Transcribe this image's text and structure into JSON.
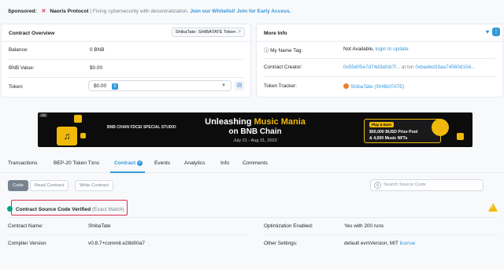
{
  "sponsor": {
    "label": "Sponsored:",
    "brand": "Naoris Protocol",
    "desc": " | Fixing cybersecurity with decentralization.",
    "cta": "Join our Whitelist! Join for Early Access."
  },
  "overview": {
    "title": "Contract Overview",
    "token_pill": "ShibaTate: SHIBATATE Token",
    "rows": [
      {
        "key": "Balance:",
        "value": "0 BNB"
      },
      {
        "key": "BNB Value:",
        "value": "$0.00"
      },
      {
        "key": "Token:",
        "value": "$0.00",
        "badge": "5"
      }
    ]
  },
  "more_info": {
    "title": "More Info",
    "name_tag_key": "My Name Tag:",
    "name_tag_value": "Not Available,",
    "name_tag_link": "login to update",
    "creator_key": "Contract Creator:",
    "creator_addr": "0x55d05e7d74d3afcb7f...",
    "creator_at": "at txn",
    "creator_txn": "0xbaded33aa74560d154...",
    "tracker_key": "Token Tracker:",
    "tracker_value": "ShibaTate (SHIBATATE)"
  },
  "banner": {
    "ad": "AD",
    "partners": "BNB CHAIN    FDCEI    SPECIAL STUDIO",
    "headline_a": "Unleashing ",
    "headline_b": "Music Mania",
    "headline2": "on BNB Chain",
    "dates": "July 21 - Aug 31, 2022",
    "promo_tag": "Play & Earn",
    "promo_line1": "$50,000 BUSD Prize Pool",
    "promo_line2": "& 4,000 Music NFTs"
  },
  "tabs": [
    "Transactions",
    "BEP-20 Token Txns",
    "Contract",
    "Events",
    "Analytics",
    "Info",
    "Comments"
  ],
  "subtabs": [
    "Code",
    "Read Contract",
    "Write Contract"
  ],
  "search": {
    "placeholder": "Search Source Code"
  },
  "verified": {
    "title": "Contract Source Code Verified",
    "note": "(Exact Match)"
  },
  "details": {
    "name_key": "Contract Name:",
    "name_value": "ShibaTate",
    "opt_key": "Optimization Enabled:",
    "opt_value": "Yes with 200 runs",
    "compiler_key": "Compiler Version",
    "compiler_value": "v0.8.7+commit.e28d00a7",
    "other_key": "Other Settings:",
    "other_value": "default evmVersion, MIT",
    "other_link": "license"
  }
}
